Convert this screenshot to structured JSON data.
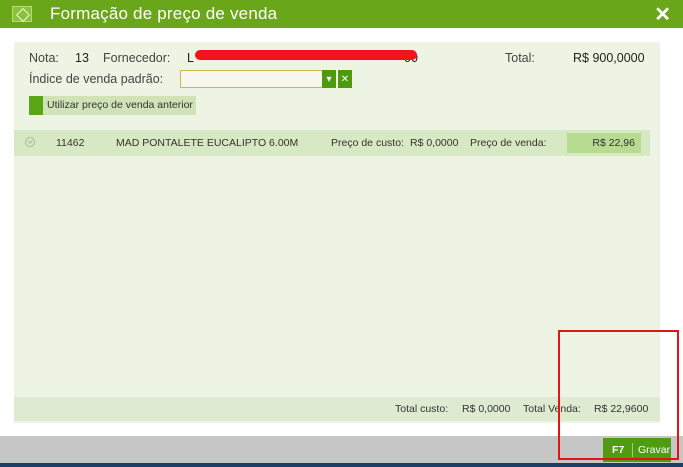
{
  "window": {
    "title": "Formação de preço de venda"
  },
  "header": {
    "nota_label": "Nota:",
    "nota_value": "13",
    "fornecedor_label": "Fornecedor:",
    "fornecedor_value_start": "L",
    "fornecedor_value_end": "00",
    "total_label": "Total:",
    "total_value": "R$ 900,0000",
    "indice_label": "Índice de venda padrão:",
    "indice_value": ""
  },
  "prev_button_label": "Utilizar preço de venda anterior",
  "items": [
    {
      "code": "11462",
      "description": "MAD PONTALETE EUCALIPTO 6.00M",
      "custo_label": "Preço de custo:",
      "custo_value": "R$ 0,0000",
      "venda_label": "Preço de venda:",
      "venda_value": "R$ 22,96"
    }
  ],
  "footer": {
    "total_custo_label": "Total custo:",
    "total_custo_value": "R$ 0,0000",
    "total_venda_label": "Total Venda:",
    "total_venda_value": "R$ 22,9600"
  },
  "save_button": {
    "key": "F7",
    "label": "Gravar"
  },
  "colors": {
    "accent": "#6aa61a",
    "button": "#4f9c10",
    "panel": "#edf4e3",
    "highlight": "#e01616"
  }
}
